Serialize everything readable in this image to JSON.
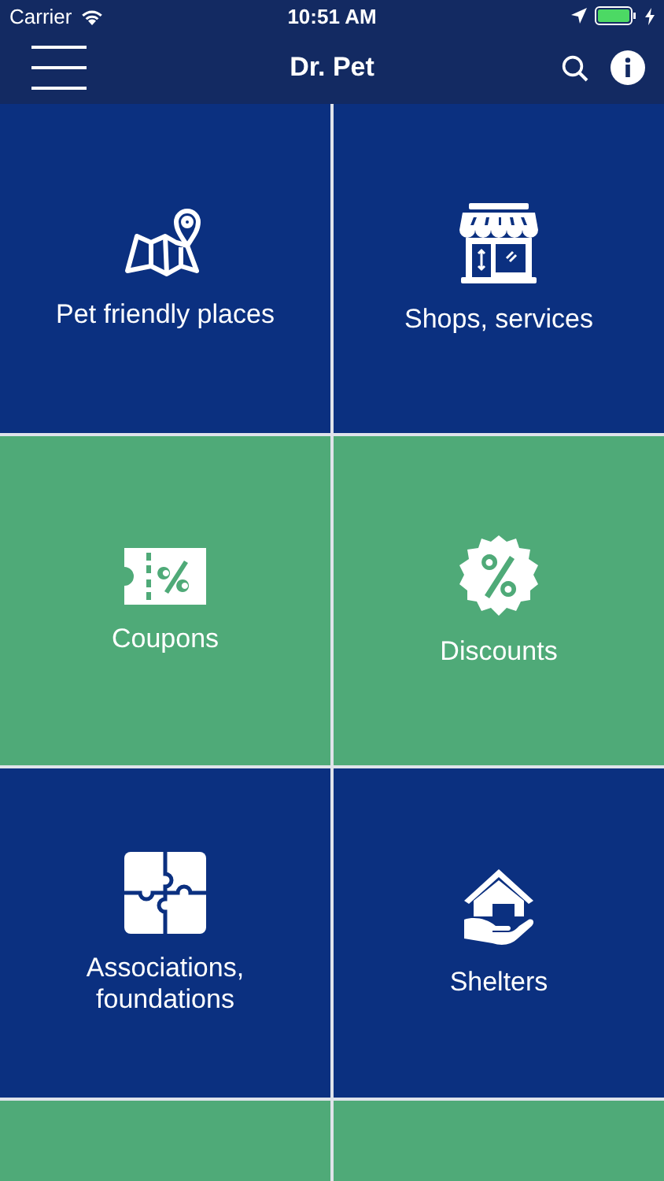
{
  "status_bar": {
    "carrier": "Carrier",
    "time": "10:51 AM"
  },
  "nav_bar": {
    "title": "Dr. Pet"
  },
  "tiles": [
    {
      "kind": "map",
      "label": "Pet friendly places",
      "color": "#0b3080"
    },
    {
      "kind": "shop",
      "label": "Shops, services",
      "color": "#0b3080"
    },
    {
      "kind": "coupon",
      "label": "Coupons",
      "color": "#4faa78"
    },
    {
      "kind": "discount",
      "label": "Discounts",
      "color": "#4faa78"
    },
    {
      "kind": "puzzle",
      "label": "Associations, foundations",
      "color": "#0b3080"
    },
    {
      "kind": "shelter",
      "label": "Shelters",
      "color": "#0b3080"
    },
    {
      "kind": "blank",
      "color": "#4faa78"
    },
    {
      "kind": "blank",
      "color": "#4faa78"
    }
  ]
}
